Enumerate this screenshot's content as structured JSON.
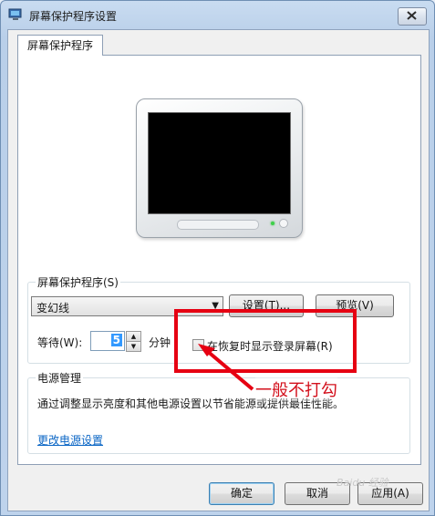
{
  "window": {
    "title": "屏幕保护程序设置",
    "close_label": "×"
  },
  "tab": {
    "label": "屏幕保护程序"
  },
  "screensaver": {
    "group_label": "屏幕保护程序(S)",
    "selected": "变幻线",
    "settings_button": "设置(T)...",
    "preview_button": "预览(V)",
    "wait_label": "等待(W):",
    "wait_value": "5",
    "unit_label": "分钟",
    "resume_checkbox_label": "在恢复时显示登录屏幕(R)",
    "resume_checked": false
  },
  "power": {
    "group_label": "电源管理",
    "description": "通过调整显示亮度和其他电源设置以节省能源或提供最佳性能。",
    "link": "更改电源设置"
  },
  "buttons": {
    "ok": "确定",
    "cancel": "取消",
    "apply": "应用(A)"
  },
  "annotation": {
    "text": "一般不打勾",
    "color": "#e60012"
  },
  "watermark": {
    "text": "Baidu 经验"
  },
  "icons": {
    "app": "display-settings-icon",
    "close": "close-icon",
    "dropdown": "chevron-down-icon",
    "spin_up": "spin-up-icon",
    "spin_down": "spin-down-icon"
  }
}
